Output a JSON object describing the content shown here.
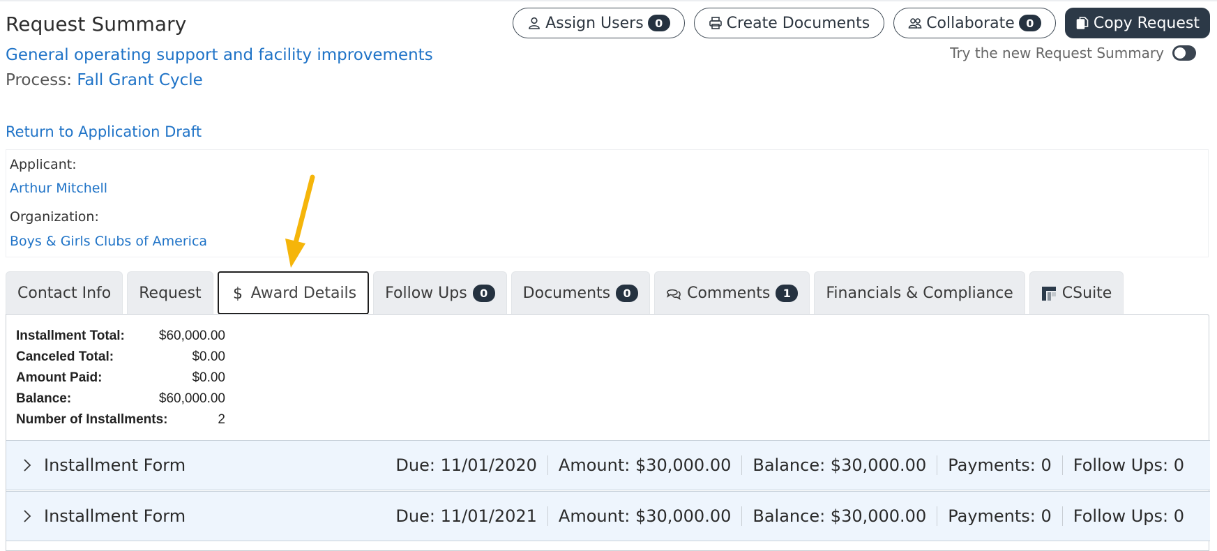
{
  "header": {
    "title": "Request Summary",
    "purpose": "General operating support and facility improvements",
    "process_label": "Process:",
    "process_value": "Fall Grant Cycle",
    "return_link": "Return to Application Draft"
  },
  "toolbar": {
    "assign_users": {
      "label": "Assign Users",
      "count": "0",
      "icon": "user-icon"
    },
    "create_documents": {
      "label": "Create Documents",
      "icon": "printer-icon"
    },
    "collaborate": {
      "label": "Collaborate",
      "count": "0",
      "icon": "users-icon"
    },
    "copy_request": {
      "label": "Copy Request",
      "icon": "copy-icon"
    }
  },
  "try_new": {
    "label": "Try the new Request Summary",
    "enabled": false
  },
  "applicant": {
    "applicant_label": "Applicant:",
    "applicant_name": "Arthur Mitchell",
    "organization_label": "Organization:",
    "organization_name": "Boys & Girls Clubs of America"
  },
  "tabs": [
    {
      "label": "Contact Info"
    },
    {
      "label": "Request"
    },
    {
      "label": "Award Details",
      "icon": "dollar-icon",
      "active": true
    },
    {
      "label": "Follow Ups",
      "count": "0"
    },
    {
      "label": "Documents",
      "count": "0"
    },
    {
      "label": "Comments",
      "count": "1",
      "icon": "comments-icon"
    },
    {
      "label": "Financials & Compliance"
    },
    {
      "label": "CSuite",
      "icon": "csuite-logo-icon"
    }
  ],
  "summary": [
    {
      "label": "Installment Total:",
      "value": "$60,000.00"
    },
    {
      "label": "Canceled Total:",
      "value": "$0.00"
    },
    {
      "label": "Amount Paid:",
      "value": "$0.00"
    },
    {
      "label": "Balance:",
      "value": "$60,000.00"
    },
    {
      "label": "Number of Installments:",
      "value": "2"
    }
  ],
  "installments": [
    {
      "name": "Installment Form",
      "due": "Due: 11/01/2020",
      "amount": "Amount: $30,000.00",
      "balance": "Balance: $30,000.00",
      "payments": "Payments: 0",
      "follow_ups": "Follow Ups: 0"
    },
    {
      "name": "Installment Form",
      "due": "Due: 11/01/2021",
      "amount": "Amount: $30,000.00",
      "balance": "Balance: $30,000.00",
      "payments": "Payments: 0",
      "follow_ups": "Follow Ups: 0"
    }
  ],
  "colors": {
    "link": "#1f73c7",
    "dark": "#2c3947",
    "arrow": "#f5b50a",
    "installment_bg": "#eef5fd"
  }
}
